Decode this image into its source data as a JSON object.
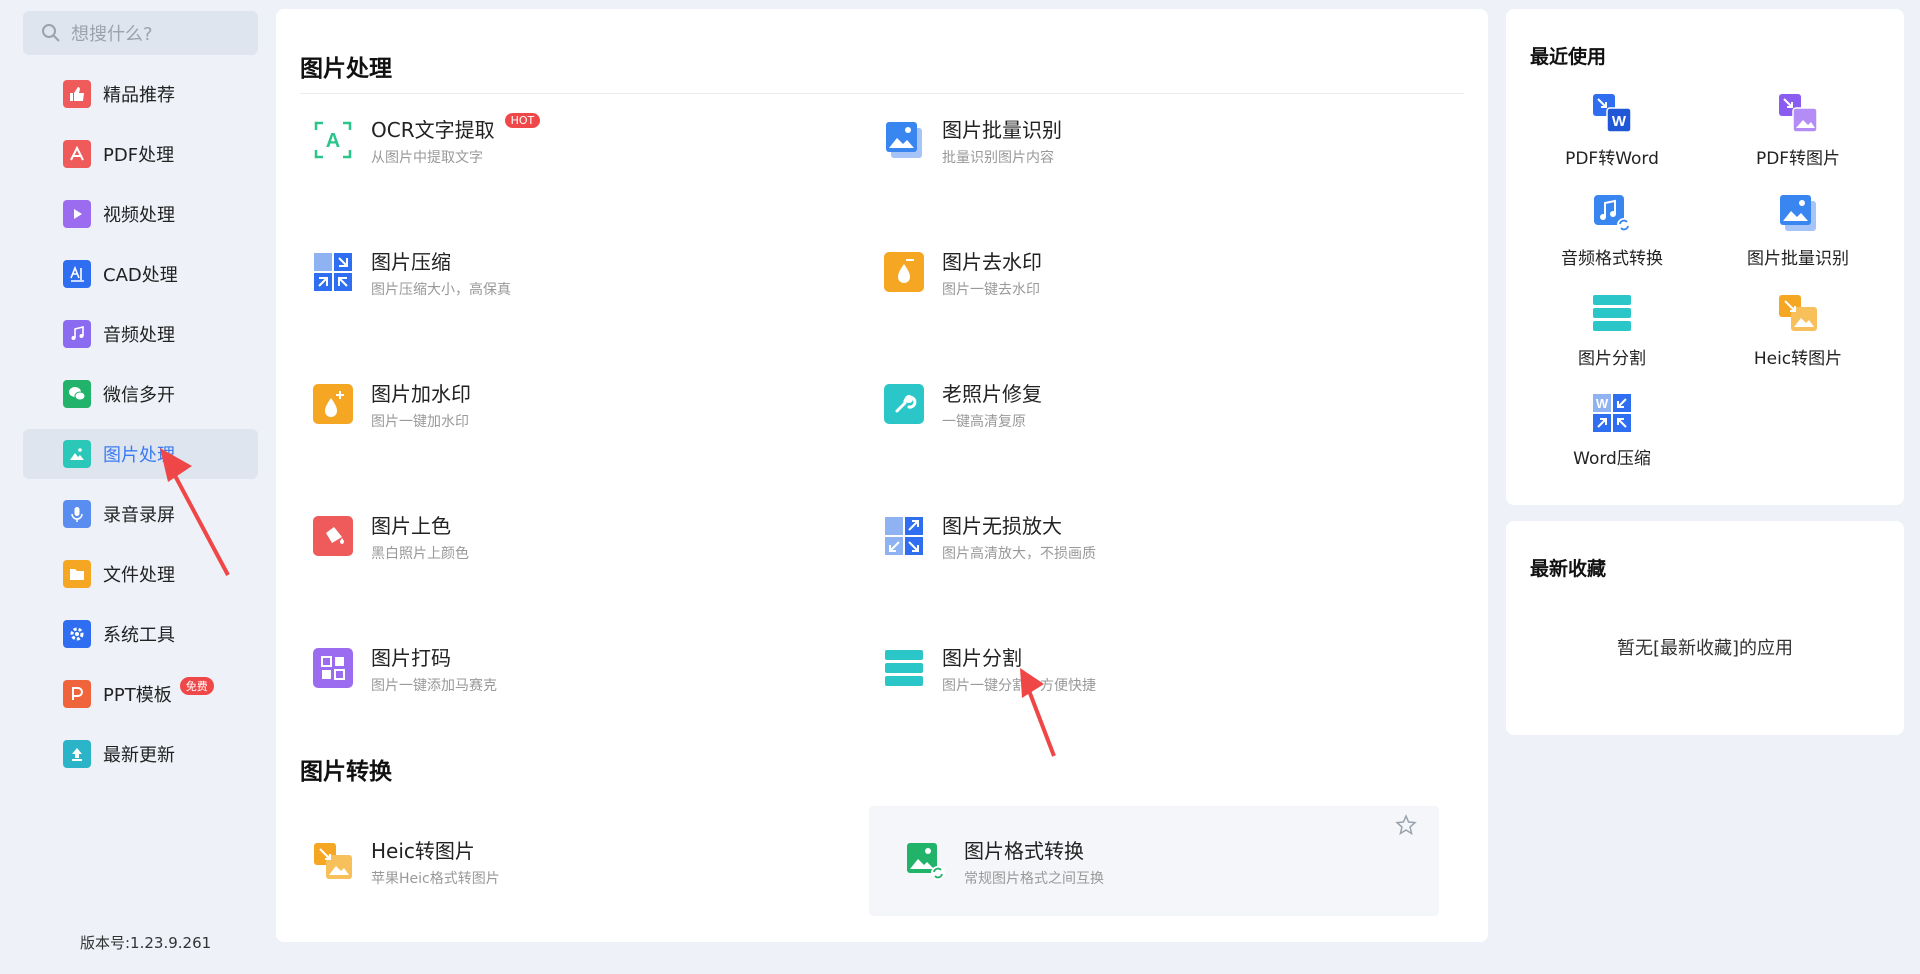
{
  "search": {
    "placeholder": "想搜什么?"
  },
  "sidebar": {
    "items": [
      {
        "label": "精品推荐",
        "icon": "thumbs-up-icon",
        "color": "#ef5a5a"
      },
      {
        "label": "PDF处理",
        "icon": "pdf-icon",
        "color": "#ef5a5a"
      },
      {
        "label": "视频处理",
        "icon": "play-icon",
        "color": "#9b6cf0"
      },
      {
        "label": "CAD处理",
        "icon": "cad-icon",
        "color": "#2f6ef0"
      },
      {
        "label": "音频处理",
        "icon": "music-icon",
        "color": "#8b6cf0"
      },
      {
        "label": "微信多开",
        "icon": "wechat-icon",
        "color": "#22b36b"
      },
      {
        "label": "图片处理",
        "icon": "image-icon",
        "color": "#2bc7b8"
      },
      {
        "label": "录音录屏",
        "icon": "mic-icon",
        "color": "#5a8df0"
      },
      {
        "label": "文件处理",
        "icon": "folder-icon",
        "color": "#f5a623"
      },
      {
        "label": "系统工具",
        "icon": "gear-icon",
        "color": "#2f6ef0"
      },
      {
        "label": "PPT模板",
        "icon": "ppt-icon",
        "color": "#f0643c",
        "badge": "免费"
      },
      {
        "label": "最新更新",
        "icon": "upload-icon",
        "color": "#2bb4c8"
      }
    ],
    "version": "版本号:1.23.9.261"
  },
  "main": {
    "section1_title": "图片处理",
    "section2_title": "图片转换",
    "tools": [
      {
        "name": "OCR文字提取",
        "desc": "从图片中提取文字",
        "badge": "HOT",
        "icon": "ocr-icon"
      },
      {
        "name": "图片批量识别",
        "desc": "批量识别图片内容",
        "icon": "batch-image-icon"
      },
      {
        "name": "图片压缩",
        "desc": "图片压缩大小，高保真",
        "icon": "compress-icon"
      },
      {
        "name": "图片去水印",
        "desc": "图片一键去水印",
        "icon": "remove-watermark-icon"
      },
      {
        "name": "图片加水印",
        "desc": "图片一键加水印",
        "icon": "add-watermark-icon"
      },
      {
        "name": "老照片修复",
        "desc": "一键高清复原",
        "icon": "repair-icon"
      },
      {
        "name": "图片上色",
        "desc": "黑白照片上颜色",
        "icon": "paint-bucket-icon"
      },
      {
        "name": "图片无损放大",
        "desc": "图片高清放大，不损画质",
        "icon": "enlarge-icon"
      },
      {
        "name": "图片打码",
        "desc": "图片一键添加马赛克",
        "icon": "mosaic-icon"
      },
      {
        "name": "图片分割",
        "desc": "图片一键分割，方便快捷",
        "icon": "split-icon"
      }
    ],
    "convert_tools": [
      {
        "name": "Heic转图片",
        "desc": "苹果Heic格式转图片",
        "icon": "heic-icon"
      },
      {
        "name": "图片格式转换",
        "desc": "常规图片格式之间互换",
        "icon": "format-convert-icon"
      }
    ]
  },
  "recent": {
    "title": "最近使用",
    "items": [
      {
        "label": "PDF转Word",
        "icon": "pdf-to-word-icon"
      },
      {
        "label": "PDF转图片",
        "icon": "pdf-to-image-icon"
      },
      {
        "label": "音频格式转换",
        "icon": "audio-convert-icon"
      },
      {
        "label": "图片批量识别",
        "icon": "batch-image-icon"
      },
      {
        "label": "图片分割",
        "icon": "split-icon"
      },
      {
        "label": "Heic转图片",
        "icon": "heic-icon"
      },
      {
        "label": "Word压缩",
        "icon": "word-compress-icon"
      }
    ]
  },
  "favorites": {
    "title": "最新收藏",
    "empty_text": "暂无[最新收藏]的应用"
  }
}
